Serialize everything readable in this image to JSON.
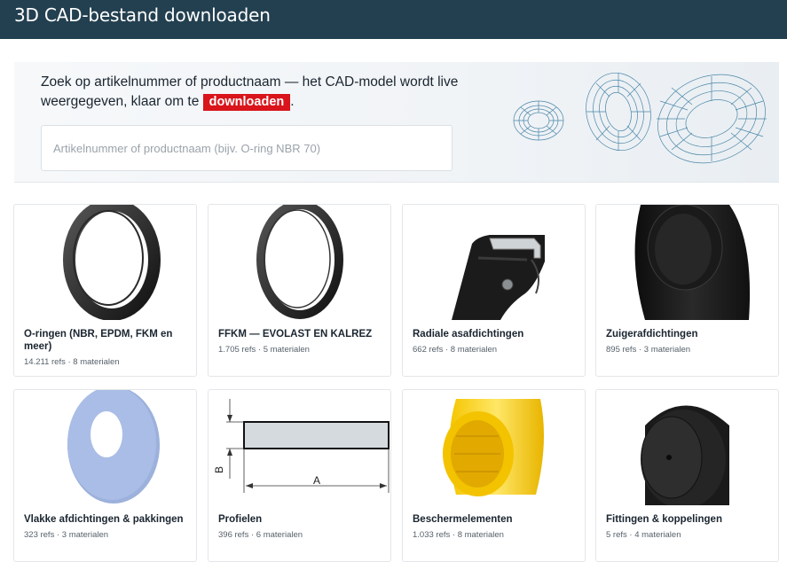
{
  "header": {
    "title": "3D CAD-bestand downloaden"
  },
  "hero": {
    "text_before": "Zoek op artikelnummer of productnaam — het CAD-model wordt live weergegeven, klaar om te ",
    "highlight": "downloaden",
    "text_after": ".",
    "search_placeholder": "Artikelnummer of productnaam (bijv. O-ring NBR 70)",
    "search_value": ""
  },
  "colors": {
    "header_bg": "#234050",
    "highlight_bg": "#d9141b",
    "torus_wire": "#4a86a8"
  },
  "categories": [
    {
      "title": "O-ringen (NBR, EPDM, FKM en meer)",
      "meta": "14.211 refs · 8 materialen",
      "icon": "o-ring-icon"
    },
    {
      "title": "FFKM — EVOLAST EN KALREZ",
      "meta": "1.705 refs · 5 materialen",
      "icon": "ffkm-o-ring-icon"
    },
    {
      "title": "Radiale asafdichtingen",
      "meta": "662 refs · 8 materialen",
      "icon": "radial-shaft-seal-icon"
    },
    {
      "title": "Zuigerafdichtingen",
      "meta": "895 refs · 3 materialen",
      "icon": "piston-seal-icon"
    },
    {
      "title": "Vlakke afdichtingen & pakkingen",
      "meta": "323 refs · 3 materialen",
      "icon": "flat-gasket-icon"
    },
    {
      "title": "Profielen",
      "meta": "396 refs · 6 materialen",
      "icon": "profile-drawing-icon",
      "dim_a": "A",
      "dim_b": "B"
    },
    {
      "title": "Beschermelementen",
      "meta": "1.033 refs · 8 materialen",
      "icon": "protective-cap-icon"
    },
    {
      "title": "Fittingen & koppelingen",
      "meta": "5 refs · 4 materialen",
      "icon": "fitting-icon"
    }
  ]
}
